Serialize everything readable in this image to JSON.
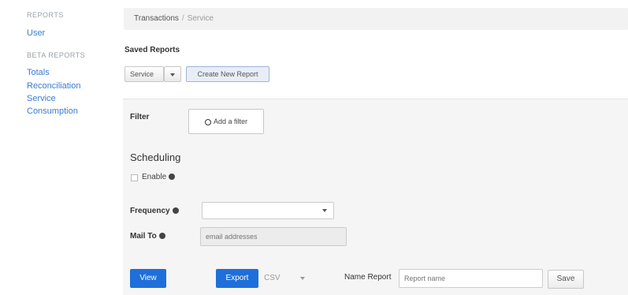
{
  "sidebar": {
    "section1_title": "REPORTS",
    "items1": [
      {
        "label": "User"
      }
    ],
    "section2_title": "BETA REPORTS",
    "items2": [
      {
        "label": "Totals"
      },
      {
        "label": "Reconciliation"
      },
      {
        "label": "Service"
      },
      {
        "label": "Consumption"
      }
    ]
  },
  "breadcrumb": {
    "parent": "Transactions",
    "separator": "/",
    "current": "Service"
  },
  "saved_reports": {
    "title": "Saved Reports",
    "dropdown_value": "Service",
    "create_button": "Create New Report"
  },
  "filter": {
    "label": "Filter",
    "add_button": "Add a filter"
  },
  "scheduling": {
    "title": "Scheduling",
    "enable_label": "Enable",
    "frequency_label": "Frequency",
    "frequency_value": "",
    "mail_to_label": "Mail To",
    "mail_to_placeholder": "email addresses"
  },
  "actions": {
    "view_button": "View",
    "export_button": "Export",
    "format_value": "CSV",
    "name_report_label": "Name Report",
    "report_name_placeholder": "Report name",
    "save_button": "Save"
  },
  "colors": {
    "link": "#3a7bd5",
    "primary": "#1e6fd9"
  }
}
